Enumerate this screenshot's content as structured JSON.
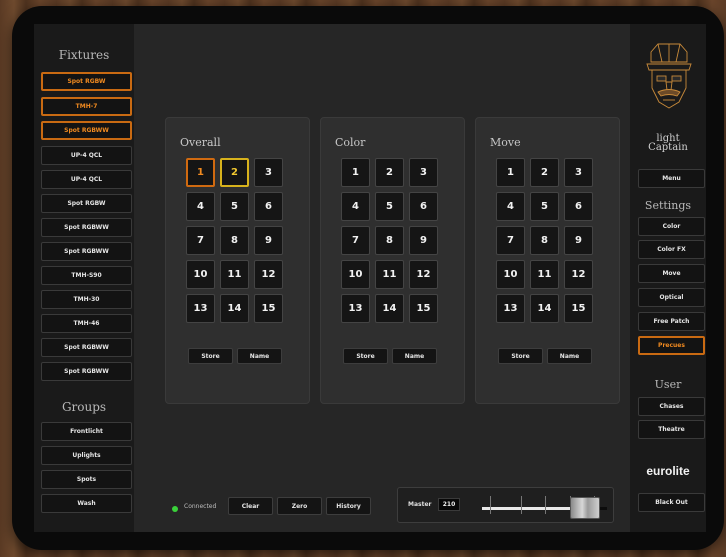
{
  "fixtures": {
    "title": "Fixtures",
    "items": [
      {
        "label": "Spot RGBW",
        "selected": true
      },
      {
        "label": "TMH-7",
        "selected": true
      },
      {
        "label": "Spot RGBWW",
        "selected": true
      },
      {
        "label": "UP-4 QCL",
        "selected": false
      },
      {
        "label": "UP-4 QCL",
        "selected": false
      },
      {
        "label": "Spot RGBW",
        "selected": false
      },
      {
        "label": "Spot RGBWW",
        "selected": false
      },
      {
        "label": "Spot RGBWW",
        "selected": false
      },
      {
        "label": "TMH-S90",
        "selected": false
      },
      {
        "label": "TMH-30",
        "selected": false
      },
      {
        "label": "TMH-46",
        "selected": false
      },
      {
        "label": "Spot RGBWW",
        "selected": false
      },
      {
        "label": "Spot RGBWW",
        "selected": false
      }
    ]
  },
  "groups": {
    "title": "Groups",
    "items": [
      "Frontlicht",
      "Uplights",
      "Spots",
      "Wash"
    ]
  },
  "panels": [
    {
      "title": "Overall",
      "pads": [
        "1",
        "2",
        "3",
        "4",
        "5",
        "6",
        "7",
        "8",
        "9",
        "10",
        "11",
        "12",
        "13",
        "14",
        "15"
      ],
      "store_label": "Store",
      "name_label": "Name"
    },
    {
      "title": "Color",
      "pads": [
        "1",
        "2",
        "3",
        "4",
        "5",
        "6",
        "7",
        "8",
        "9",
        "10",
        "11",
        "12",
        "13",
        "14",
        "15"
      ],
      "store_label": "Store",
      "name_label": "Name"
    },
    {
      "title": "Move",
      "pads": [
        "1",
        "2",
        "3",
        "4",
        "5",
        "6",
        "7",
        "8",
        "9",
        "10",
        "11",
        "12",
        "13",
        "14",
        "15"
      ],
      "store_label": "Store",
      "name_label": "Name"
    }
  ],
  "bottom": {
    "status": "Connected",
    "status_color": "#3ad13a",
    "clear_label": "Clear",
    "zero_label": "Zero",
    "history_label": "History",
    "master_label": "Master",
    "master_value": "210",
    "master_level": 0.82
  },
  "right": {
    "brand_line1": "light",
    "brand_line2": "Captain",
    "menu_label": "Menu",
    "settings_title": "Settings",
    "settings_items": [
      {
        "label": "Color",
        "selected": false
      },
      {
        "label": "Color FX",
        "selected": false
      },
      {
        "label": "Move",
        "selected": false
      },
      {
        "label": "Optical",
        "selected": false
      },
      {
        "label": "Free Patch",
        "selected": false
      },
      {
        "label": "Precues",
        "selected": true
      }
    ],
    "user_title": "User",
    "user_items": [
      "Chases",
      "Theatre"
    ],
    "vendor": "eurolite",
    "blackout_label": "Black Out"
  },
  "colors": {
    "accent_orange": "#d06a10",
    "accent_yellow": "#d7b21c",
    "background": "#262626"
  }
}
